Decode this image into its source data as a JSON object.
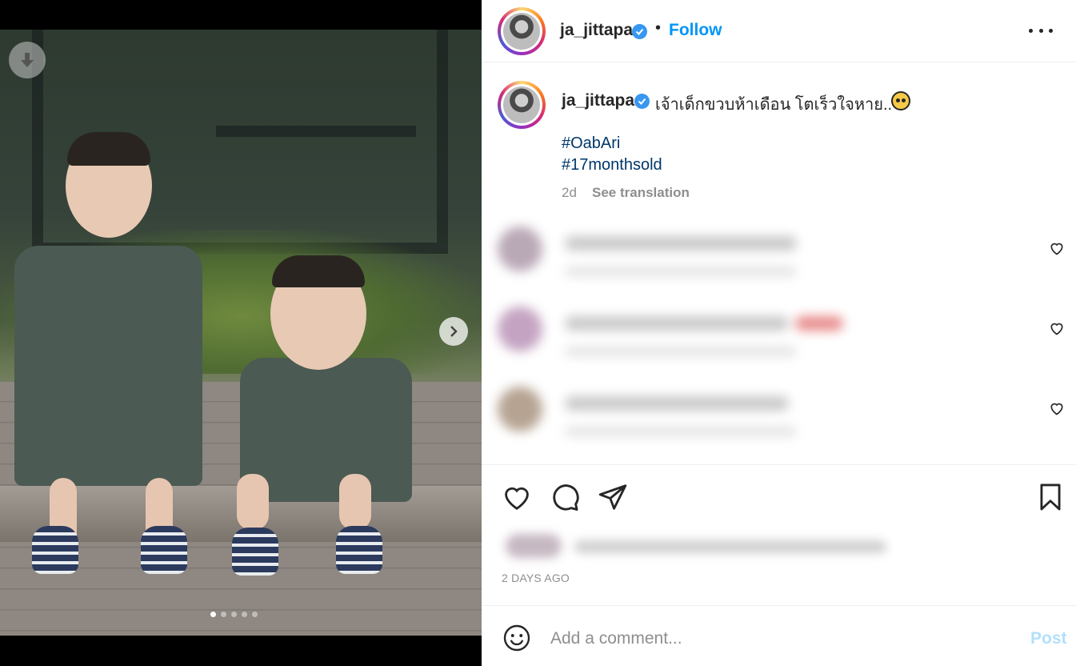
{
  "media": {
    "download_icon": "arrow-down-icon",
    "next_icon": "chevron-right-icon",
    "slide_count": 5,
    "active_slide": 1
  },
  "header": {
    "username": "ja_jittapa",
    "separator": "•",
    "follow_label": "Follow",
    "more_icon": "ellipsis-icon"
  },
  "caption": {
    "username": "ja_jittapa",
    "text": "เจ้าเด็กขวบห้าเดือน โตเร็วใจหาย..",
    "hashtags": [
      "#OabAri",
      "#17monthsold"
    ],
    "time": "2d",
    "see_translation": "See translation"
  },
  "actions": {
    "like_icon": "heart-icon",
    "comment_icon": "comment-bubble-icon",
    "share_icon": "paper-plane-icon",
    "save_icon": "bookmark-icon"
  },
  "post_age": "2 DAYS AGO",
  "comment_box": {
    "placeholder": "Add a comment...",
    "post_label": "Post"
  },
  "colors": {
    "accent": "#0095f6",
    "hashtag": "#00376b",
    "muted": "#8e8e8e",
    "post_disabled": "#b2dffc"
  }
}
